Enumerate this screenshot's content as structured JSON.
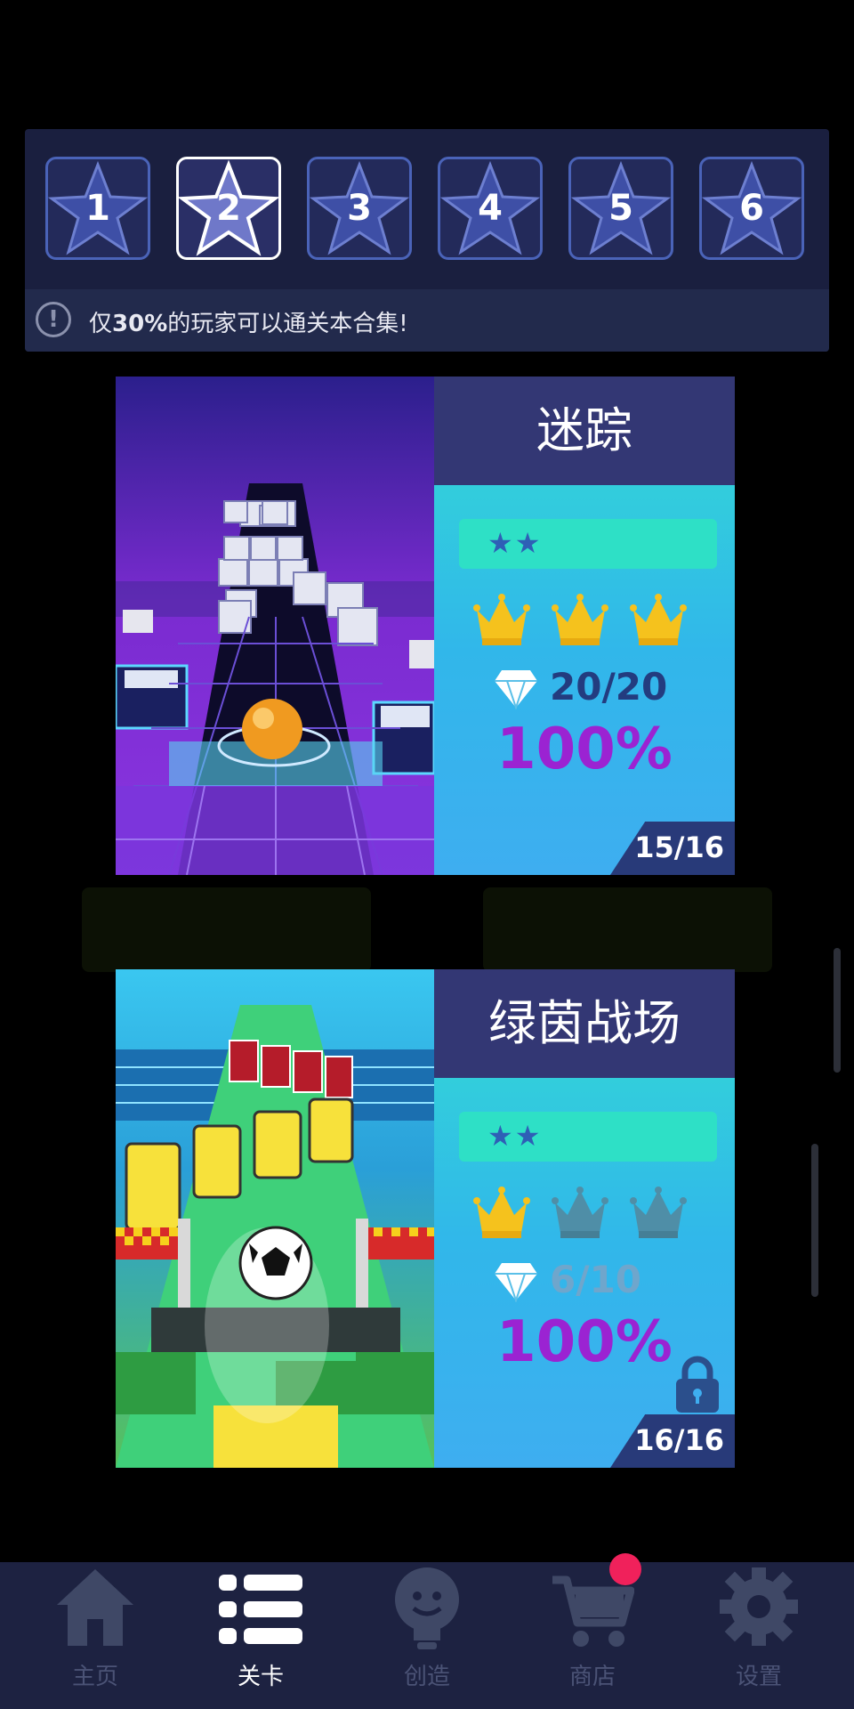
{
  "stage_tabs": [
    {
      "number": "1",
      "active": false
    },
    {
      "number": "2",
      "active": true
    },
    {
      "number": "3",
      "active": false
    },
    {
      "number": "4",
      "active": false
    },
    {
      "number": "5",
      "active": false
    },
    {
      "number": "6",
      "active": false
    }
  ],
  "notice": {
    "icon": "exclamation-icon",
    "prefix": "仅",
    "highlight": "30%",
    "suffix": "的玩家可以通关本合集!"
  },
  "levels": [
    {
      "title": "迷踪",
      "difficulty_stars": "★★",
      "crowns_earned": 3,
      "crowns_total": 3,
      "gems": "20/20",
      "progress": "100%",
      "index": "15/16",
      "locked": false
    },
    {
      "title": "绿茵战场",
      "difficulty_stars": "★★",
      "crowns_earned": 1,
      "crowns_total": 3,
      "gems": "6/10",
      "progress": "100%",
      "index": "16/16",
      "locked": true
    }
  ],
  "nav": {
    "items": [
      {
        "label": "主页",
        "icon": "home-icon",
        "active": false
      },
      {
        "label": "关卡",
        "icon": "list-icon",
        "active": true
      },
      {
        "label": "创造",
        "icon": "lightbulb-icon",
        "active": false
      },
      {
        "label": "商店",
        "icon": "cart-icon",
        "active": false,
        "badge": true
      },
      {
        "label": "设置",
        "icon": "gear-icon",
        "active": false
      }
    ]
  },
  "colors": {
    "panel": "#1a1f3f",
    "tab_border": "#4a63b8",
    "crown_gold": "#f5c21d",
    "crown_grey": "#4f8ea7",
    "percent_purple": "#9b23d2",
    "badge_red": "#f0215b"
  }
}
